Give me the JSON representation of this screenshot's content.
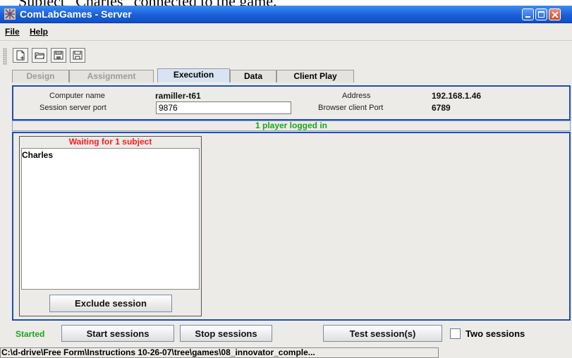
{
  "doc_caption": "Subject “Charles” connected to the game.",
  "window": {
    "title": "ComLabGames - Server"
  },
  "menu": {
    "file": "File",
    "help": "Help"
  },
  "toolbar": {
    "icons": [
      "new-document-icon",
      "open-folder-icon",
      "save-as-icon",
      "save-icon"
    ]
  },
  "tabs": [
    {
      "label": "Design",
      "state": "disabled"
    },
    {
      "label": "Assignment",
      "state": "disabled"
    },
    {
      "label": "Execution",
      "state": "selected"
    },
    {
      "label": "Data",
      "state": "normal"
    },
    {
      "label": "Client Play",
      "state": "normal"
    }
  ],
  "info": {
    "computer_name_label": "Computer name",
    "computer_name": "ramiller-t61",
    "address_label": "Address",
    "address": "192.168.1.46",
    "session_port_label": "Session server port",
    "session_port": "9876",
    "browser_port_label": "Browser client Port",
    "browser_port": "6789"
  },
  "status": {
    "players_logged": "1 player logged in"
  },
  "session": {
    "waiting": "Waiting for 1 subject",
    "subjects": [
      "Charles"
    ],
    "exclude_button": "Exclude session"
  },
  "controls": {
    "state": "Started",
    "start": "Start sessions",
    "stop": "Stop sessions",
    "test": "Test session(s)",
    "two_sessions": "Two sessions",
    "two_sessions_checked": false
  },
  "statusbar": {
    "path": "C:\\d-drive\\Free Form\\Instructions 10-26-07\\tree\\games\\08_innovator_comple..."
  },
  "colors": {
    "accent_blue": "#1f4fb0",
    "status_green": "#1aa61a",
    "alert_red": "#ff1a1a"
  }
}
